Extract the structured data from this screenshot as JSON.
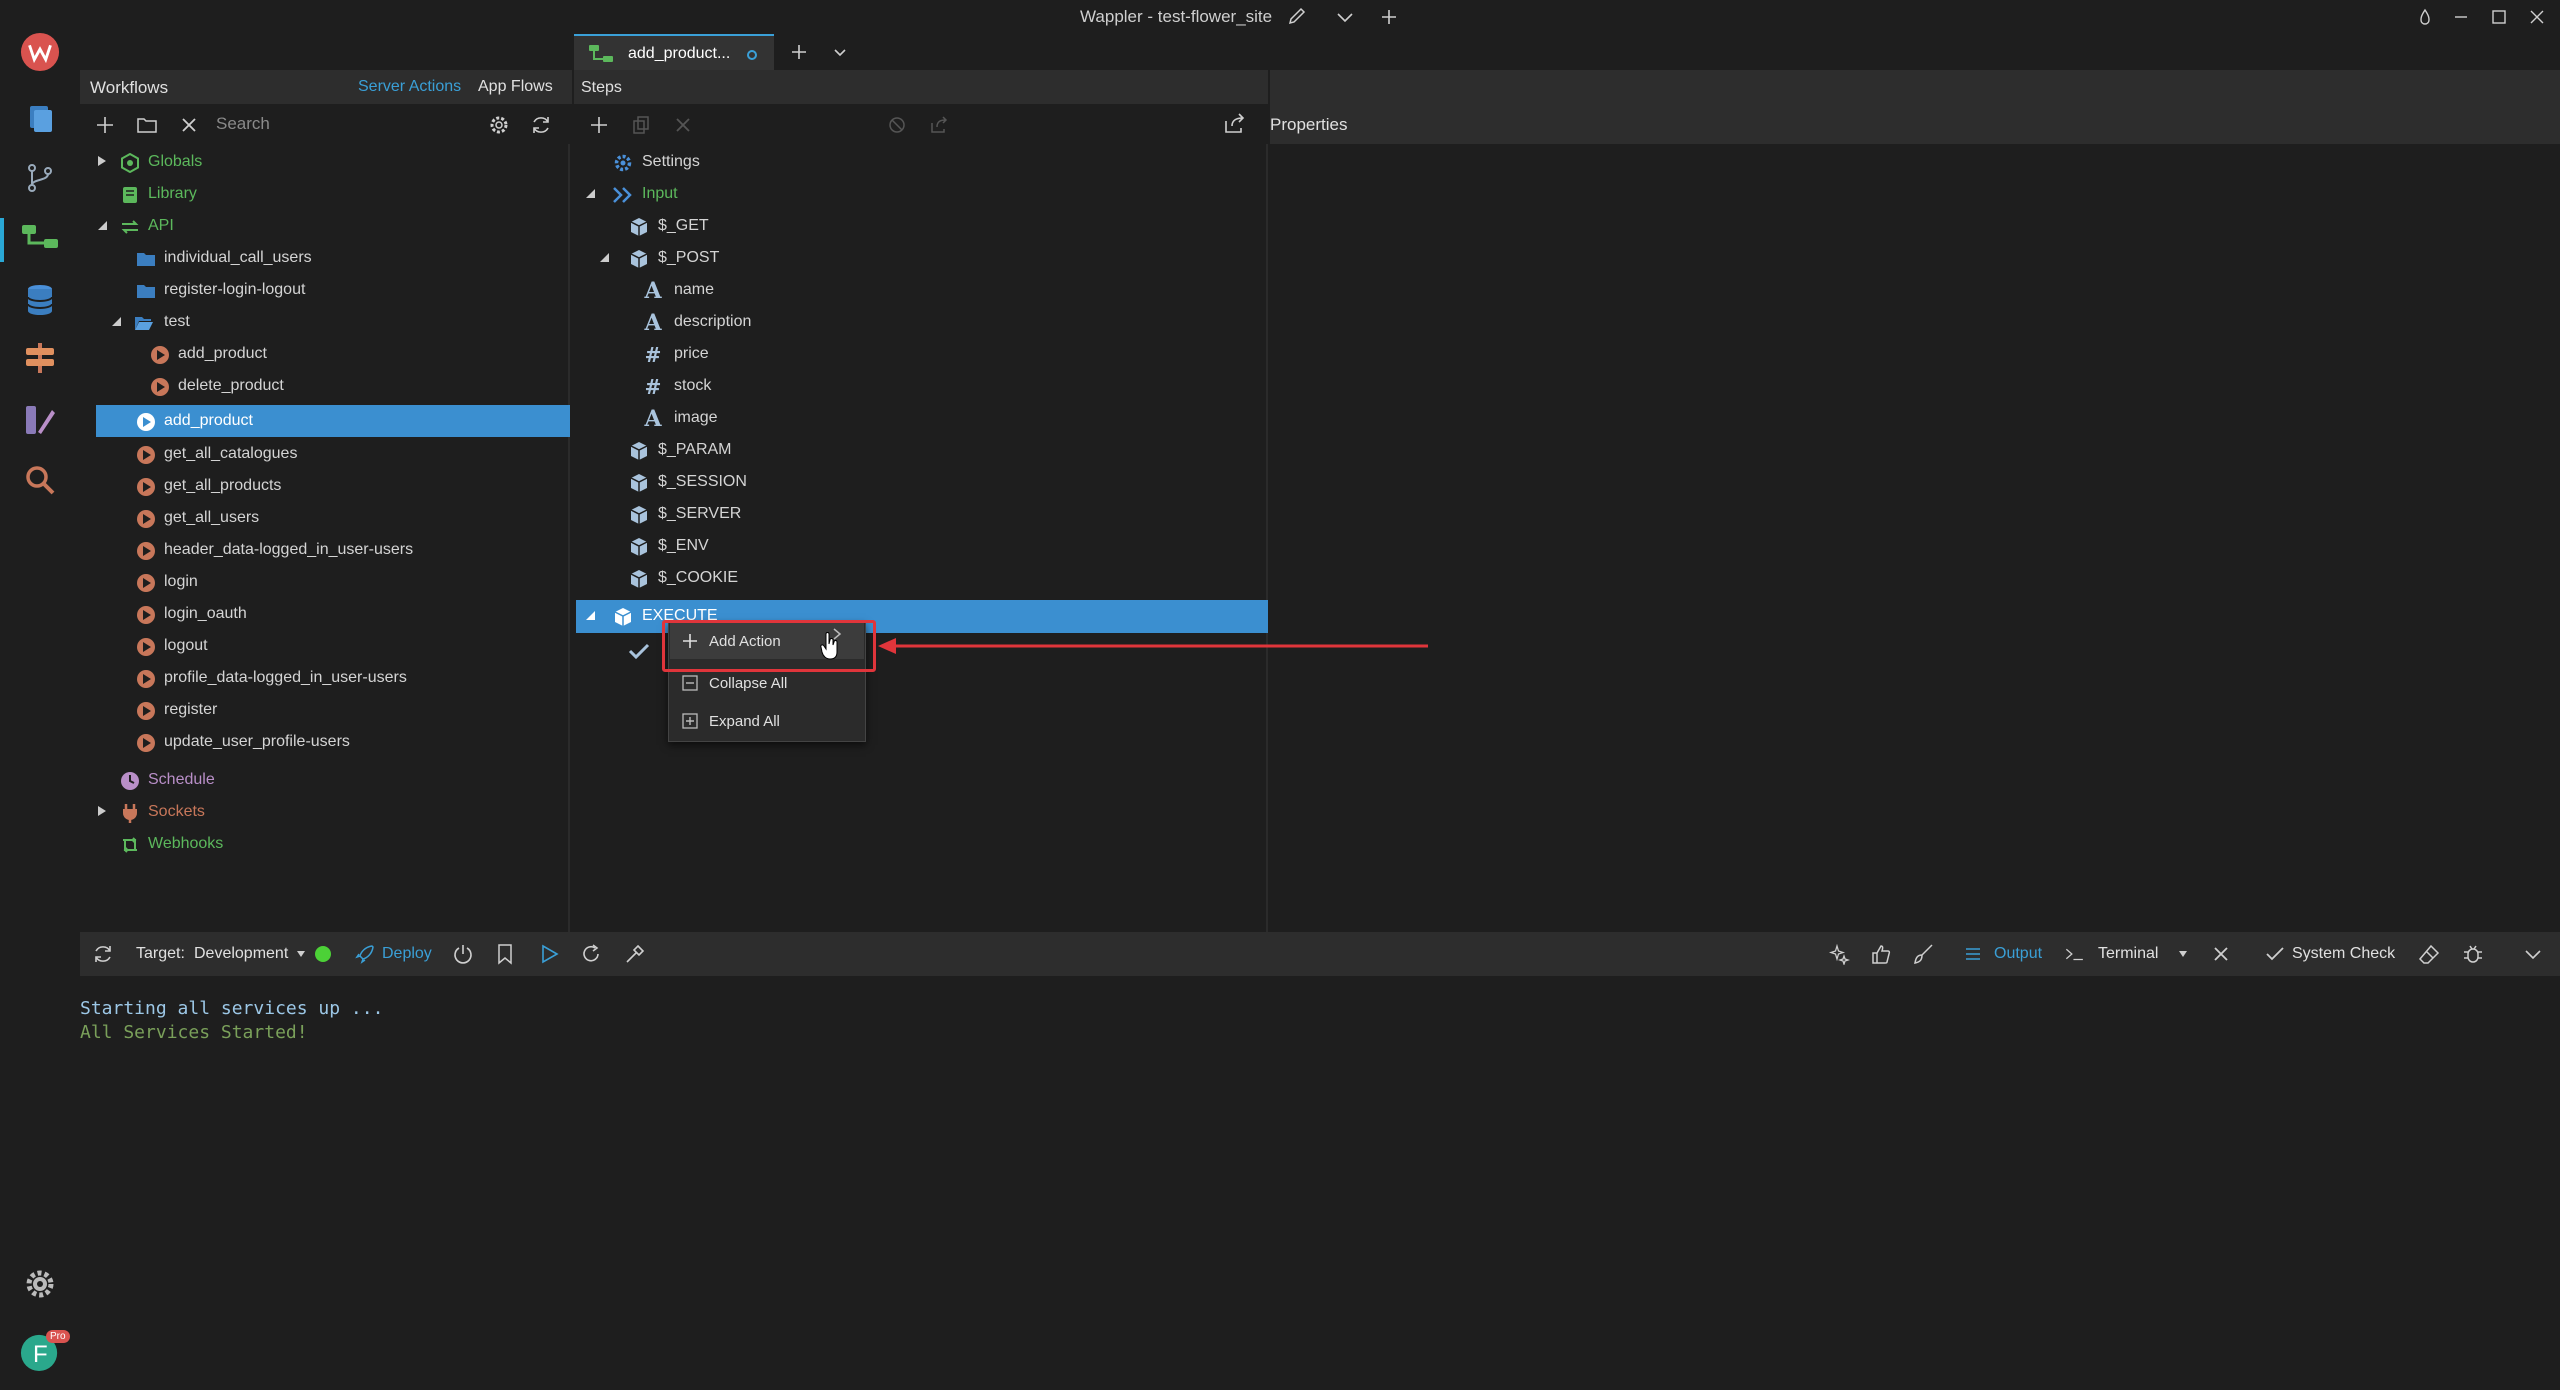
{
  "window": {
    "title": "Wappler - test-flower_site"
  },
  "workflows": {
    "header": "Workflows",
    "tabs": [
      "Server Actions",
      "App Flows"
    ],
    "search_placeholder": "Search",
    "tree": [
      {
        "label": "Globals"
      },
      {
        "label": "Library"
      },
      {
        "label": "API"
      },
      {
        "label": "individual_call_users"
      },
      {
        "label": "register-login-logout"
      },
      {
        "label": "test"
      },
      {
        "label": "add_product"
      },
      {
        "label": "delete_product"
      },
      {
        "label": "add_product"
      },
      {
        "label": "get_all_catalogues"
      },
      {
        "label": "get_all_products"
      },
      {
        "label": "get_all_users"
      },
      {
        "label": "header_data-logged_in_user-users"
      },
      {
        "label": "login"
      },
      {
        "label": "login_oauth"
      },
      {
        "label": "logout"
      },
      {
        "label": "profile_data-logged_in_user-users"
      },
      {
        "label": "register"
      },
      {
        "label": "update_user_profile-users"
      },
      {
        "label": "Schedule"
      },
      {
        "label": "Sockets"
      },
      {
        "label": "Webhooks"
      }
    ]
  },
  "editor_tab": {
    "label": "add_product..."
  },
  "steps": {
    "header": "Steps",
    "tree": [
      {
        "label": "Settings"
      },
      {
        "label": "Input"
      },
      {
        "label": "$_GET"
      },
      {
        "label": "$_POST"
      },
      {
        "label": "name",
        "type": "A"
      },
      {
        "label": "description",
        "type": "A"
      },
      {
        "label": "price",
        "type": "#"
      },
      {
        "label": "stock",
        "type": "#"
      },
      {
        "label": "image",
        "type": "A"
      },
      {
        "label": "$_PARAM"
      },
      {
        "label": "$_SESSION"
      },
      {
        "label": "$_SERVER"
      },
      {
        "label": "$_ENV"
      },
      {
        "label": "$_COOKIE"
      },
      {
        "label": "EXECUTE"
      }
    ]
  },
  "properties": {
    "header": "Properties"
  },
  "context_menu": {
    "items": [
      {
        "label": "Add Action"
      },
      {
        "label": "Collapse All"
      },
      {
        "label": "Expand All"
      }
    ]
  },
  "bottom_bar": {
    "target_label": "Target:",
    "target_value": "Development",
    "deploy": "Deploy",
    "output": "Output",
    "terminal": "Terminal",
    "system_check": "System Check"
  },
  "console": {
    "lines": [
      "Starting all services up ...",
      "All Services Started!"
    ]
  },
  "user": {
    "initial": "F",
    "badge": "Pro"
  },
  "colors": {
    "accent": "#3b8fd0",
    "highlight": "#e0353b",
    "status_ok": "#4cd137"
  }
}
